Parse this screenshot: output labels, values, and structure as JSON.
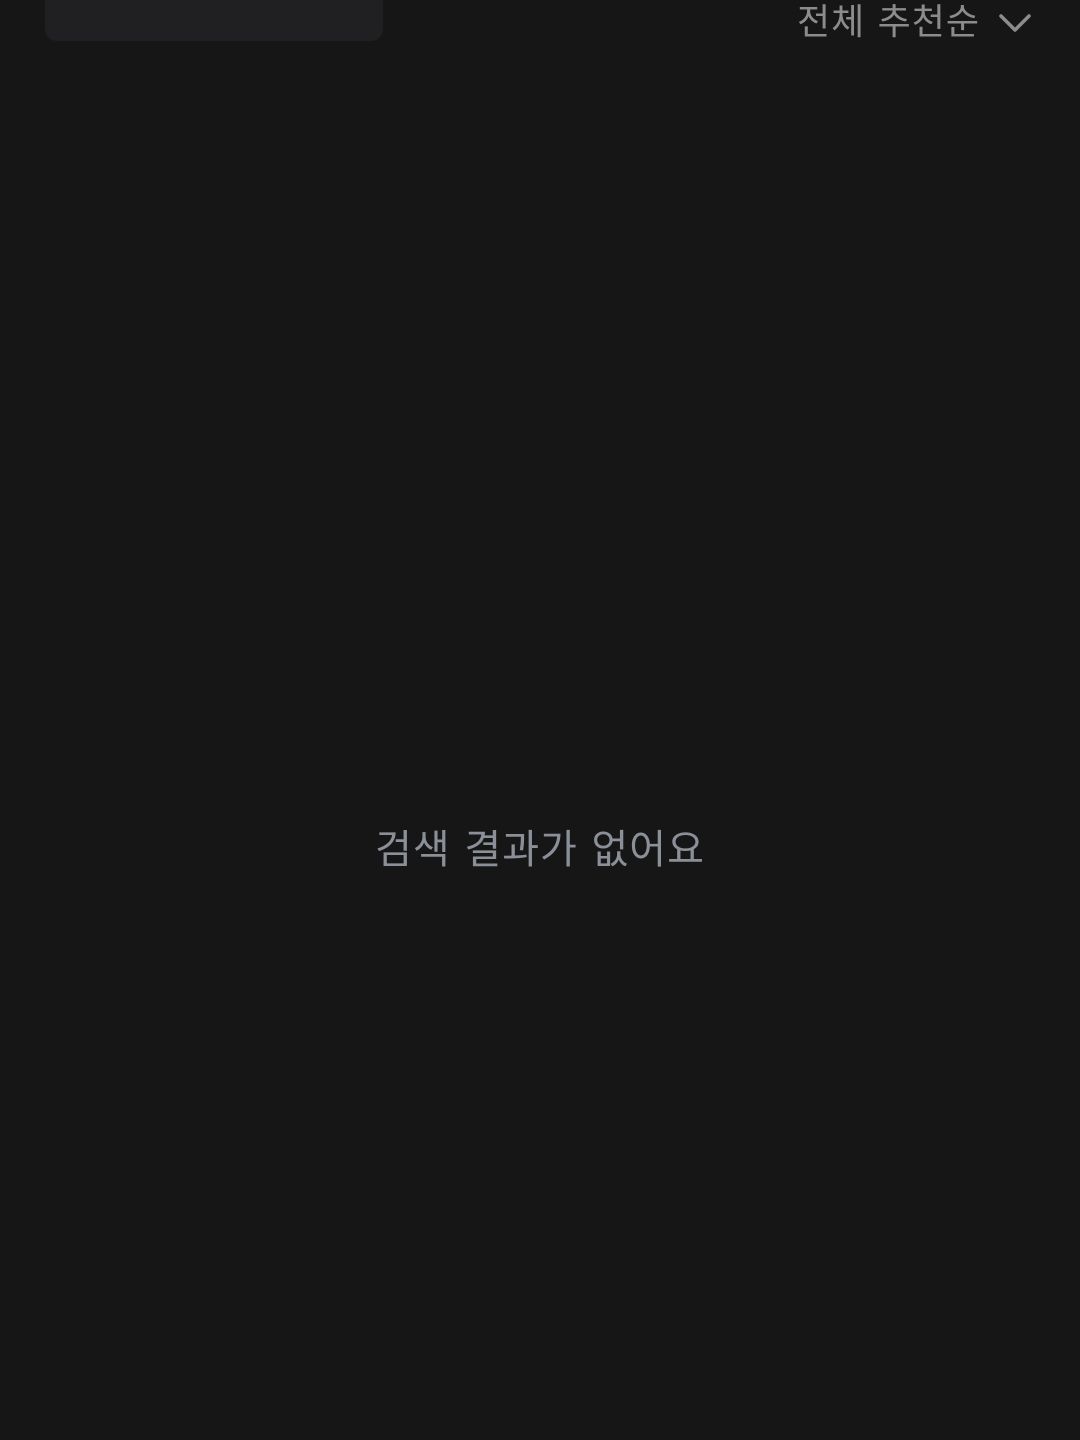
{
  "header": {
    "sort_label": "전체 추천순",
    "sort_icon": "chevron-down-icon"
  },
  "empty_state": {
    "message": "검색 결과가 없어요"
  },
  "colors": {
    "background": "#161617",
    "chip_background": "#202022",
    "sort_text": "#8c8c8f",
    "empty_text": "#8a8f98"
  }
}
